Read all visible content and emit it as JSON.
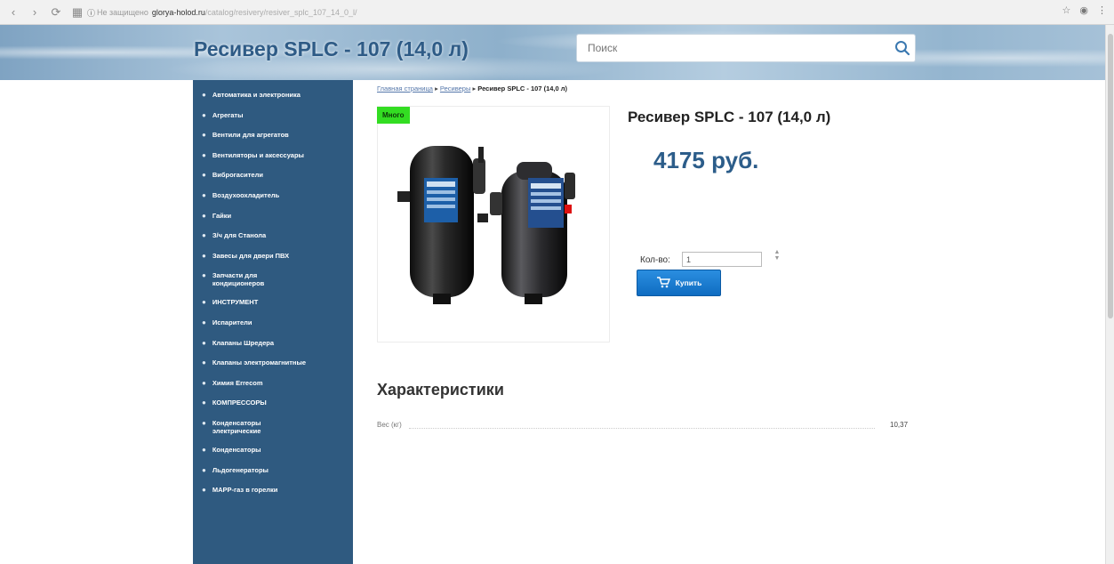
{
  "browser": {
    "security": "Не защищено",
    "host": "glorya-holod.ru",
    "path": "/catalog/resivery/resiver_splc_107_14_0_l/"
  },
  "header": {
    "title": "Ресивер SPLC - 107 (14,0 л)",
    "search_placeholder": "Поиск"
  },
  "sidebar": {
    "items": [
      "Автоматика и электроника",
      "Агрегаты",
      "Вентили для агрегатов",
      "Вентиляторы и аксессуары",
      "Виброгасители",
      "Воздухоохладитель",
      "Гайки",
      "З/ч для Станола",
      "Завесы для двери ПВХ",
      "Запчасти для кондиционеров",
      "ИНСТРУМЕНТ",
      "Испарители",
      "Клапаны Шредера",
      "Клапаны электромагнитные",
      "Химия Errecom",
      "КОМПРЕССОРЫ",
      "Конденсаторы электрические",
      "Конденсаторы",
      "Льдогенераторы",
      "МАРР-газ в горелки"
    ]
  },
  "breadcrumb": {
    "home": "Главная страница",
    "section": "Ресиверы",
    "current": "Ресивер SPLC - 107 (14,0 л)"
  },
  "product": {
    "badge": "Много",
    "title": "Ресивер SPLC - 107 (14,0 л)",
    "price": "4175 руб.",
    "qty_label": "Кол-во:",
    "qty_value": "1",
    "buy_label": "Купить"
  },
  "specs": {
    "title": "Характеристики",
    "rows": [
      {
        "name": "Вес (кг)",
        "value": "10,37"
      }
    ]
  }
}
